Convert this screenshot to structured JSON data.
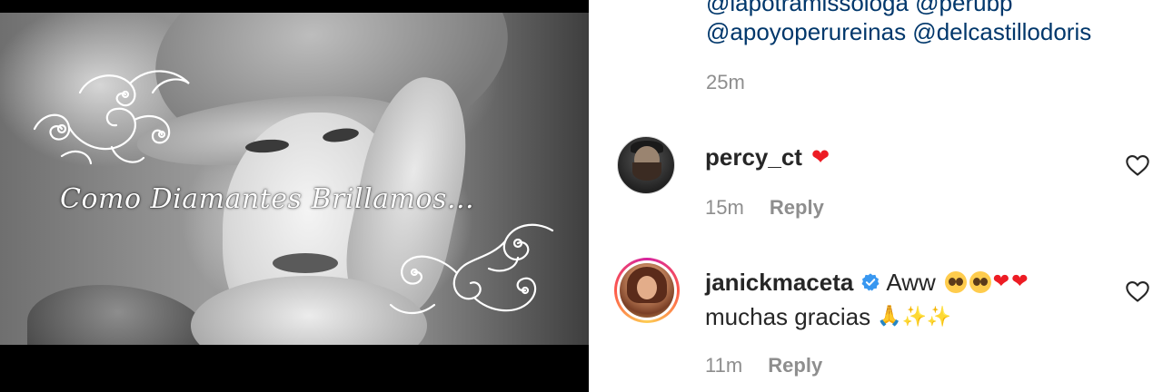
{
  "media": {
    "caption": "Como Diamantes Brillamos..."
  },
  "previous_comment": {
    "mentions_line1": "@lapotramissologa @perubp",
    "mentions_line2": "@apoyoperureinas @delcastillodoris",
    "time": "25m"
  },
  "comments": [
    {
      "username": "percy_ct",
      "text": "",
      "emoji": [
        "heart"
      ],
      "time": "15m",
      "reply_label": "Reply",
      "verified": false
    },
    {
      "username": "janickmaceta",
      "text_line1": "Aww",
      "text_line2": "muchas gracias",
      "emoji_line1": [
        "pleading-face",
        "pleading-face",
        "heart",
        "heart"
      ],
      "emoji_line2": [
        "folded-hands",
        "sparkles",
        "sparkles"
      ],
      "time": "11m",
      "reply_label": "Reply",
      "verified": true
    }
  ],
  "colors": {
    "mention_link": "#00376b",
    "secondary_text": "#8e8e8e",
    "primary_text": "#262626",
    "verified_badge": "#3897f0",
    "heart": "#ed1c24"
  }
}
